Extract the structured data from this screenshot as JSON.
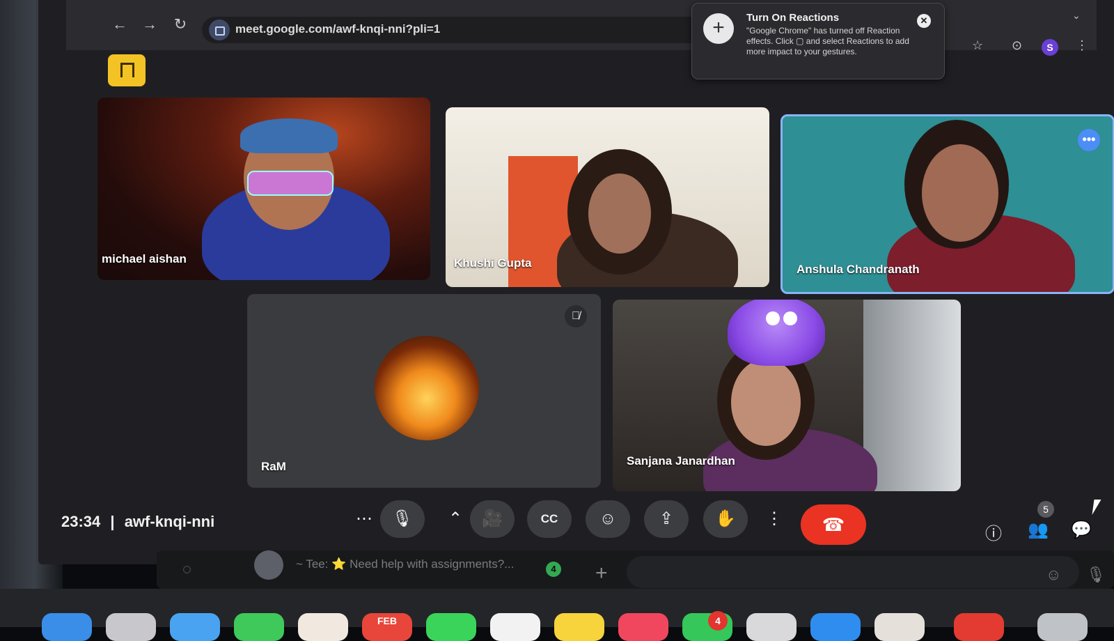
{
  "browser": {
    "url": "meet.google.com/awf-knqi-nni?pli=1",
    "profile_initial": "S"
  },
  "reactions_popup": {
    "title": "Turn On Reactions",
    "body": "\"Google Chrome\" has turned off Reaction effects. Click ▢ and select Reactions to add more impact to your gestures.",
    "close": "✕"
  },
  "participants": [
    {
      "name": "michael aishan"
    },
    {
      "name": "Khushi Gupta"
    },
    {
      "name": "Anshula Chandranath",
      "speaking": true
    },
    {
      "name": "RaM",
      "muted": true
    },
    {
      "name": "Sanjana Janardhan"
    }
  ],
  "meeting": {
    "time": "23:34",
    "separator": "|",
    "code": "awf-knqi-nni",
    "participant_count": "5"
  },
  "controls": {
    "more_options": "⋯",
    "mic": "🎙",
    "expand": "⌃",
    "camera": "🎥",
    "captions": "CC",
    "emoji": "☺",
    "present": "⇪",
    "raise_hand": "✋",
    "more_vertical": "⋮",
    "end_call": "☎"
  },
  "right_controls": {
    "info": "ⓘ",
    "people": "👥",
    "chat": "💬"
  },
  "background_app": {
    "message_preview": "~ Tee: ⭐ Need help with assignments?...",
    "unread_count": "4",
    "plus": "+"
  },
  "dock": {
    "calendar_month": "FEB",
    "badge_count": "4"
  },
  "colors": {
    "accent_blue": "#8ab4f8",
    "end_call_red": "#ea3323",
    "meet_logo_yellow": "#f3c325"
  }
}
